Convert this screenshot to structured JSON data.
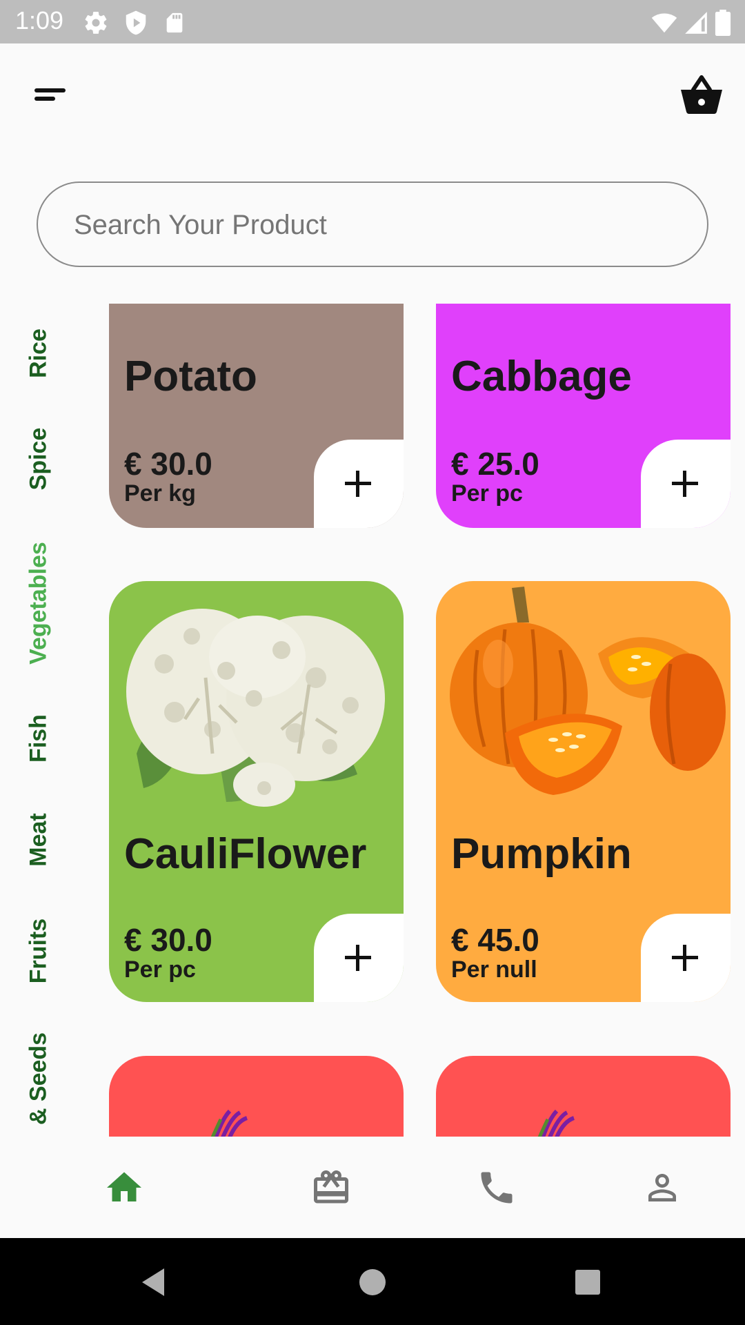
{
  "status_bar": {
    "time": "1:09",
    "icons": [
      "settings-icon",
      "shield-icon",
      "sd-card-icon",
      "wifi-icon",
      "signal-icon",
      "battery-icon"
    ]
  },
  "header": {
    "menu_icon": "menu-icon",
    "cart_icon": "basket-icon"
  },
  "search": {
    "placeholder": "Search Your Product",
    "value": ""
  },
  "categories": {
    "items": [
      {
        "label": "Rice",
        "active": false
      },
      {
        "label": "Spice",
        "active": false
      },
      {
        "label": "Vegetables",
        "active": true
      },
      {
        "label": "Fish",
        "active": false
      },
      {
        "label": "Meat",
        "active": false
      },
      {
        "label": "Fruits",
        "active": false
      },
      {
        "label": "& Seeds",
        "active": false
      }
    ],
    "active_color": "#4caf50",
    "inactive_color": "#1b5e20"
  },
  "products": [
    {
      "name": "Potato",
      "price": "€ 30.0",
      "unit": "Per kg",
      "color": "#a1887f",
      "image": ""
    },
    {
      "name": "Cabbage",
      "price": "€ 25.0",
      "unit": "Per pc",
      "color": "#e040fb",
      "image": ""
    },
    {
      "name": "CauliFlower",
      "price": "€ 30.0",
      "unit": "Per pc",
      "color": "#8bc34a",
      "image": "cauliflower-image"
    },
    {
      "name": "Pumpkin",
      "price": "€ 45.0",
      "unit": "Per null",
      "color": "#ffab40",
      "image": "pumpkin-image"
    },
    {
      "name": "",
      "price": "",
      "unit": "",
      "color": "#ff5252",
      "image": "beetroot-image"
    },
    {
      "name": "",
      "price": "",
      "unit": "",
      "color": "#ff5252",
      "image": "beetroot-image"
    }
  ],
  "bottom_nav": {
    "items": [
      {
        "icon": "home-icon",
        "active": true
      },
      {
        "icon": "gift-card-icon",
        "active": false
      },
      {
        "icon": "phone-icon",
        "active": false
      },
      {
        "icon": "profile-icon",
        "active": false
      }
    ],
    "active_color": "#388e3c",
    "inactive_color": "#757575"
  },
  "system_nav": {
    "icons": [
      "back-icon",
      "home-circle-icon",
      "recents-icon"
    ]
  }
}
